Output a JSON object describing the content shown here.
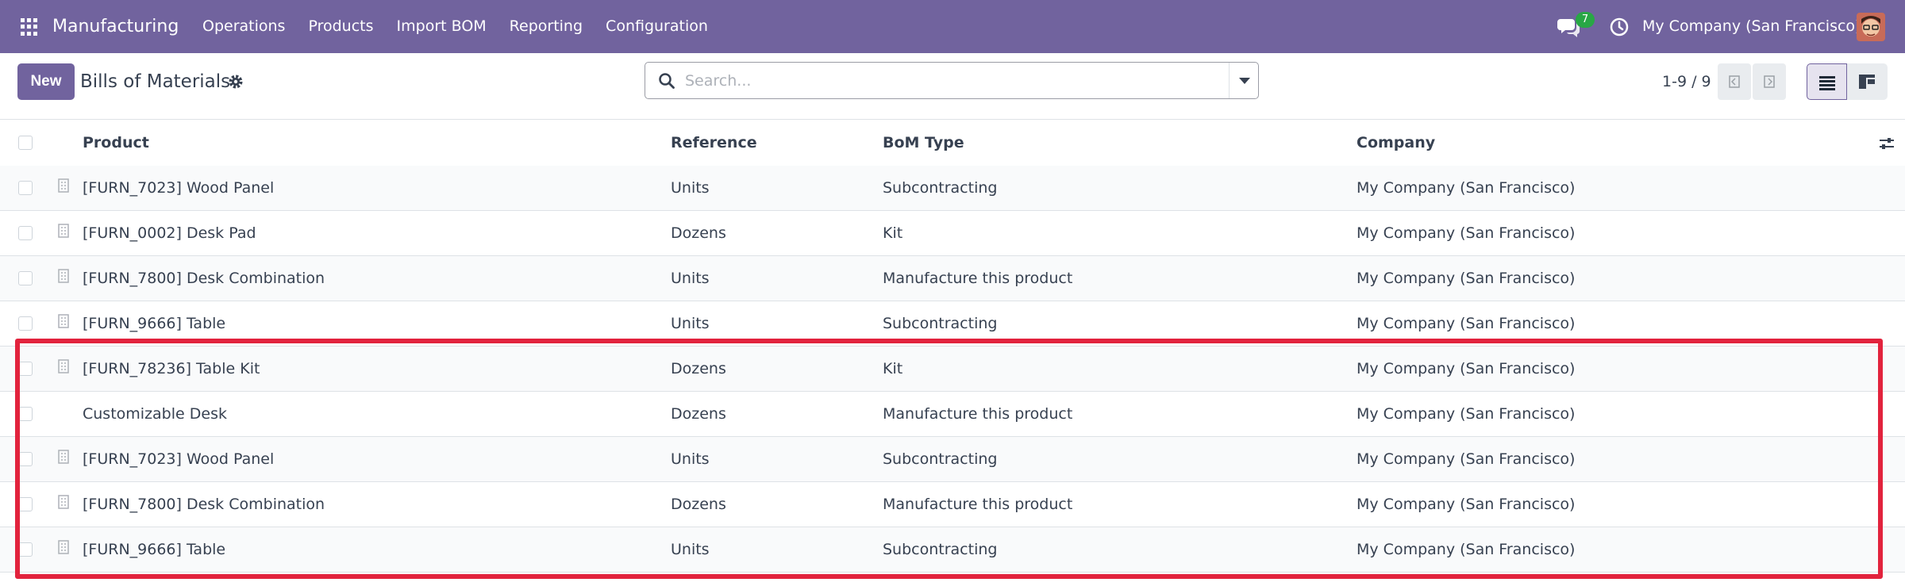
{
  "navbar": {
    "brand": "Manufacturing",
    "menu": [
      "Operations",
      "Products",
      "Import BOM",
      "Reporting",
      "Configuration"
    ],
    "messages_count": "7",
    "company": "My Company (San Francisco)",
    "icons": [
      "apps-grid-icon",
      "chat-icon",
      "clock-icon",
      "avatar"
    ]
  },
  "control": {
    "new_label": "New",
    "title": "Bills of Materials",
    "search_placeholder": "Search...",
    "pager": "1-9 / 9"
  },
  "table": {
    "columns": {
      "product": "Product",
      "reference": "Reference",
      "bom_type": "BoM Type",
      "company": "Company"
    },
    "rows": [
      {
        "product": "[FURN_7023] Wood Panel",
        "reference": "Units",
        "bom_type": "Subcontracting",
        "company": "My Company (San Francisco)"
      },
      {
        "product": "[FURN_0002] Desk Pad",
        "reference": "Dozens",
        "bom_type": "Kit",
        "company": "My Company (San Francisco)"
      },
      {
        "product": "[FURN_7800] Desk Combination",
        "reference": "Units",
        "bom_type": "Manufacture this product",
        "company": "My Company (San Francisco)"
      },
      {
        "product": "[FURN_9666] Table",
        "reference": "Units",
        "bom_type": "Subcontracting",
        "company": "My Company (San Francisco)"
      },
      {
        "product": "[FURN_78236] Table Kit",
        "reference": "Dozens",
        "bom_type": "Kit",
        "company": "My Company (San Francisco)"
      },
      {
        "product": "Customizable Desk",
        "reference": "Dozens",
        "bom_type": "Manufacture this product",
        "company": "My Company (San Francisco)"
      },
      {
        "product": "[FURN_7023] Wood Panel",
        "reference": "Units",
        "bom_type": "Subcontracting",
        "company": "My Company (San Francisco)"
      },
      {
        "product": "[FURN_7800] Desk Combination",
        "reference": "Dozens",
        "bom_type": "Manufacture this product",
        "company": "My Company (San Francisco)"
      },
      {
        "product": "[FURN_9666] Table",
        "reference": "Units",
        "bom_type": "Subcontracting",
        "company": "My Company (San Francisco)"
      }
    ]
  },
  "colors": {
    "brand": "#71639e",
    "badge": "#28a745",
    "highlight": "#e2233d"
  }
}
